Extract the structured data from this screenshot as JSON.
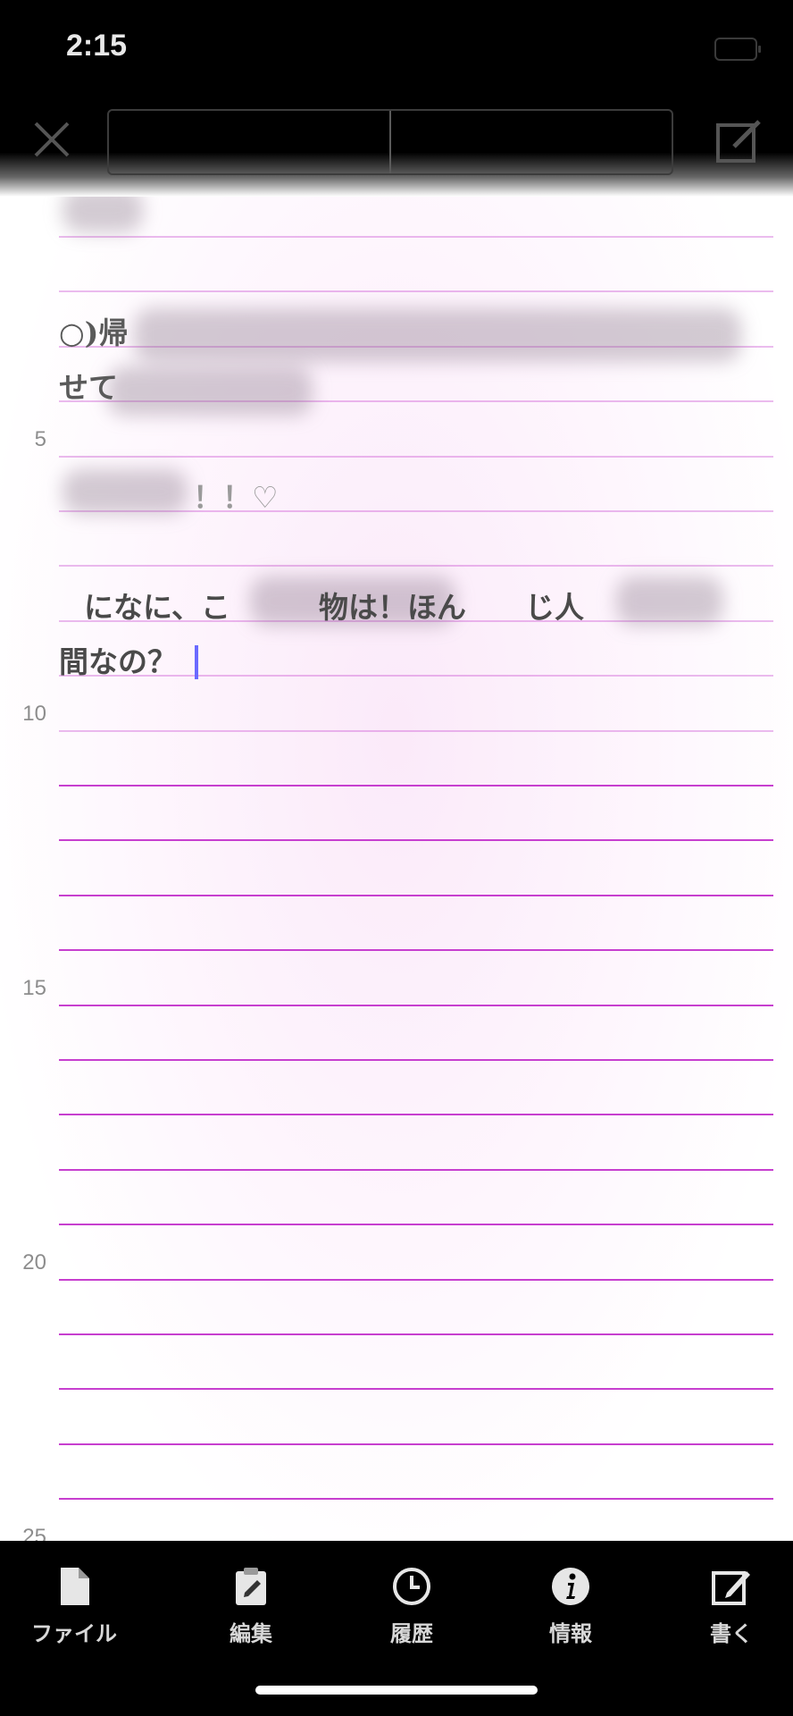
{
  "status_bar": {
    "time": "2:15"
  },
  "editor": {
    "line_numbers": [
      "5",
      "10",
      "15",
      "20",
      "25"
    ],
    "text_lines": [
      "○)帰",
      "せて",
      "！！♡",
      "になに、こ　　　物は！ほん　　じ人",
      "間なの？"
    ]
  },
  "tabbar": {
    "items": [
      {
        "label": "ファイル",
        "icon": "file-icon"
      },
      {
        "label": "編集",
        "icon": "clipboard-edit-icon"
      },
      {
        "label": "履歴",
        "icon": "clock-history-icon"
      },
      {
        "label": "情報",
        "icon": "info-icon"
      },
      {
        "label": "書く",
        "icon": "compose-icon"
      }
    ]
  },
  "colors": {
    "rule": "#c73fcf",
    "accent_tint": "#fbeafb"
  }
}
